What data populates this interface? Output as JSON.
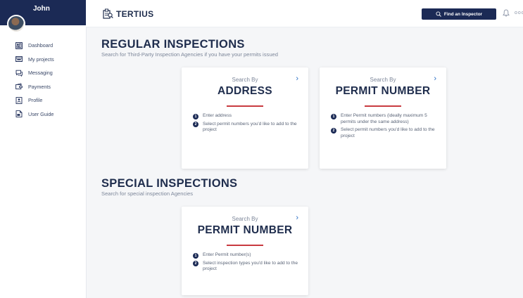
{
  "user": {
    "name": "John"
  },
  "sidebar": {
    "items": [
      {
        "label": "Dashboard",
        "icon": "dashboard-icon"
      },
      {
        "label": "My projects",
        "icon": "projects-icon"
      },
      {
        "label": "Messaging",
        "icon": "messaging-icon"
      },
      {
        "label": "Payments",
        "icon": "payments-icon"
      },
      {
        "label": "Profile",
        "icon": "profile-icon"
      },
      {
        "label": "User Guide",
        "icon": "user-guide-icon"
      }
    ]
  },
  "header": {
    "logo_text": "TERTIUS",
    "find_button": "Find an Inspector",
    "more": "ooo"
  },
  "regular": {
    "title": "REGULAR INSPECTIONS",
    "subtitle": "Search for Third-Party Inspection Agencies if you have your permits issued",
    "cards": [
      {
        "by": "Search By",
        "title": "ADDRESS",
        "steps": [
          "Enter address",
          "Select permit numbers you'd like to add to the project"
        ]
      },
      {
        "by": "Search By",
        "title": "PERMIT NUMBER",
        "steps": [
          "Enter Permit numbers (ideally maximum 5 permits under the same address)",
          "Select permit numbers you'd like to add to the project"
        ]
      }
    ]
  },
  "special": {
    "title": "SPECIAL INSPECTIONS",
    "subtitle": "Search for special inspection Agencies",
    "cards": [
      {
        "by": "Search By",
        "title": "PERMIT NUMBER",
        "steps": [
          "Enter Permit number(s)",
          "Select inspection types you'd like to add to the project"
        ]
      }
    ]
  },
  "step_numbers": [
    "1",
    "2"
  ],
  "colors": {
    "navy": "#1b2a55",
    "accent_red": "#c83a40",
    "chevron_blue": "#2a6fc4"
  }
}
